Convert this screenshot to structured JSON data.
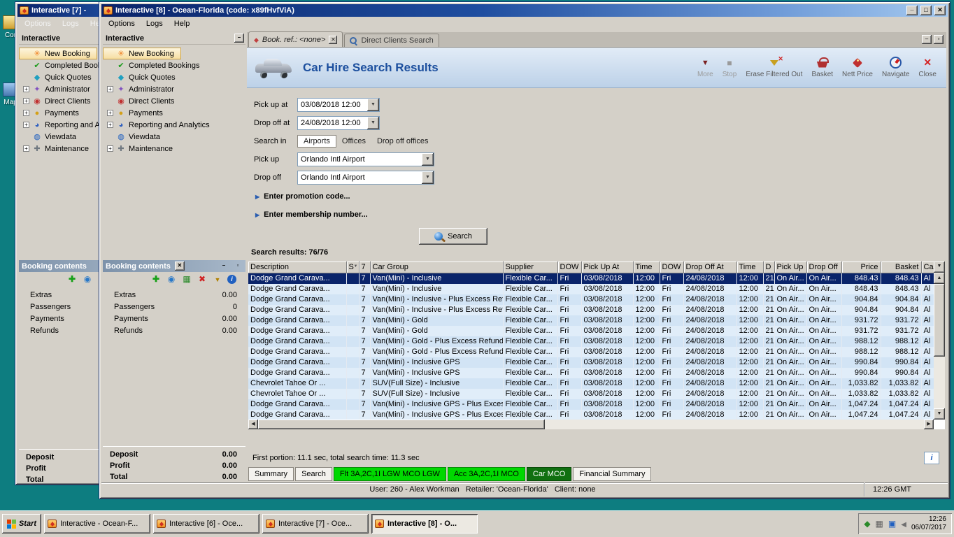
{
  "desktop": {
    "icon_labels": [
      "Cor",
      "Map"
    ]
  },
  "back_window": {
    "title": "Interactive [7] -",
    "menus": [
      "Options",
      "Logs",
      "Help"
    ],
    "sidebar_title": "Interactive",
    "tree": [
      {
        "label": "New Booking",
        "icon": "new-booking-icon",
        "expander": "",
        "selected": true
      },
      {
        "label": "Completed Bookings",
        "icon": "completed-bookings-icon",
        "expander": ""
      },
      {
        "label": "Quick Quotes",
        "icon": "quick-quotes-icon",
        "expander": ""
      },
      {
        "label": "Administrator",
        "icon": "administrator-icon",
        "expander": "+"
      },
      {
        "label": "Direct Clients",
        "icon": "direct-clients-icon",
        "expander": "+"
      },
      {
        "label": "Payments",
        "icon": "payments-icon",
        "expander": "+"
      },
      {
        "label": "Reporting and Analytics",
        "icon": "reporting-icon",
        "expander": "+"
      },
      {
        "label": "Viewdata",
        "icon": "viewdata-icon",
        "expander": ""
      },
      {
        "label": "Maintenance",
        "icon": "maintenance-icon",
        "expander": "+"
      }
    ],
    "booking_panel": {
      "title": "Booking contents",
      "items": [
        {
          "label": "Extras"
        },
        {
          "label": "Passengers"
        },
        {
          "label": "Payments"
        },
        {
          "label": "Refunds"
        }
      ],
      "totals": [
        {
          "label": "Deposit"
        },
        {
          "label": "Profit"
        },
        {
          "label": "Total"
        }
      ]
    }
  },
  "front_window": {
    "title": "Interactive [8] - Ocean-Florida (code: x89fHvfViA)",
    "menus": [
      "Options",
      "Logs",
      "Help"
    ],
    "sidebar": {
      "title": "Interactive",
      "tree": [
        {
          "label": "New Booking",
          "icon": "new-booking-icon",
          "expander": "",
          "selected": true
        },
        {
          "label": "Completed Bookings",
          "icon": "completed-bookings-icon",
          "expander": ""
        },
        {
          "label": "Quick Quotes",
          "icon": "quick-quotes-icon",
          "expander": ""
        },
        {
          "label": "Administrator",
          "icon": "administrator-icon",
          "expander": "+"
        },
        {
          "label": "Direct Clients",
          "icon": "direct-clients-icon",
          "expander": ""
        },
        {
          "label": "Payments",
          "icon": "payments-icon",
          "expander": "+"
        },
        {
          "label": "Reporting and Analytics",
          "icon": "reporting-icon",
          "expander": "+"
        },
        {
          "label": "Viewdata",
          "icon": "viewdata-icon",
          "expander": ""
        },
        {
          "label": "Maintenance",
          "icon": "maintenance-icon",
          "expander": "+"
        }
      ],
      "booking_panel": {
        "title": "Booking contents",
        "items": [
          {
            "label": "Extras",
            "value": "0.00"
          },
          {
            "label": "Passengers",
            "value": "0"
          },
          {
            "label": "Payments",
            "value": "0.00"
          },
          {
            "label": "Refunds",
            "value": "0.00"
          }
        ],
        "totals": [
          {
            "label": "Deposit",
            "value": "0.00"
          },
          {
            "label": "Profit",
            "value": "0.00"
          },
          {
            "label": "Total",
            "value": "0.00"
          }
        ]
      }
    },
    "tabs": [
      {
        "label": "Book. ref.: <none>",
        "icon": "booking-tab-icon",
        "active": true,
        "closable": true
      },
      {
        "label": "Direct Clients Search",
        "icon": "search-tab-icon",
        "active": false,
        "closable": false
      }
    ],
    "results_header": {
      "title": "Car Hire Search Results",
      "toolbar": [
        {
          "label": "More",
          "icon": "more-icon",
          "disabled": true
        },
        {
          "label": "Stop",
          "icon": "stop-icon",
          "disabled": true
        },
        {
          "label": "Erase Filtered Out",
          "icon": "erase-filter-icon",
          "disabled": false
        },
        {
          "label": "Basket",
          "icon": "basket-icon",
          "disabled": false
        },
        {
          "label": "Nett Price",
          "icon": "nett-price-icon",
          "disabled": false
        },
        {
          "label": "Navigate",
          "icon": "navigate-icon",
          "disabled": false
        },
        {
          "label": "Close",
          "icon": "close-icon",
          "disabled": false
        }
      ]
    },
    "search_form": {
      "pick_up_at": {
        "label": "Pick up at",
        "value": "03/08/2018 12:00"
      },
      "drop_off_at": {
        "label": "Drop off at",
        "value": "24/08/2018 12:00"
      },
      "search_in": {
        "label": "Search in",
        "options": [
          "Airports",
          "Offices",
          "Drop off offices"
        ],
        "selected": "Airports"
      },
      "pick_up": {
        "label": "Pick up",
        "value": "Orlando Intl Airport"
      },
      "drop_off": {
        "label": "Drop off",
        "value": "Orlando Intl Airport"
      },
      "promotion": "Enter promotion code...",
      "membership": "Enter membership number...",
      "search_button": "Search"
    },
    "results": {
      "count_text": "Search results: 76/76",
      "columns": [
        "Description",
        "S",
        "7",
        "Car Group",
        "Supplier",
        "DOW",
        "Pick Up At",
        "Time",
        "DOW",
        "Drop Off At",
        "Time",
        "D",
        "Pick Up",
        "Drop Off",
        "Price",
        "Basket",
        "Ca"
      ],
      "selected_row": 0,
      "rows": [
        [
          "Dodge Grand Carava...",
          "",
          "7",
          "Van(Mini) - Inclusive",
          "Flexible Car...",
          "Fri",
          "03/08/2018",
          "12:00",
          "Fri",
          "24/08/2018",
          "12:00",
          "21",
          "On Air...",
          "On Air...",
          "848.43",
          "848.43",
          "Al"
        ],
        [
          "Dodge Grand Carava...",
          "",
          "7",
          "Van(Mini) - Inclusive",
          "Flexible Car...",
          "Fri",
          "03/08/2018",
          "12:00",
          "Fri",
          "24/08/2018",
          "12:00",
          "21",
          "On Air...",
          "On Air...",
          "848.43",
          "848.43",
          "Al"
        ],
        [
          "Dodge Grand Carava...",
          "",
          "7",
          "Van(Mini) - Inclusive - Plus Excess Ref...",
          "Flexible Car...",
          "Fri",
          "03/08/2018",
          "12:00",
          "Fri",
          "24/08/2018",
          "12:00",
          "21",
          "On Air...",
          "On Air...",
          "904.84",
          "904.84",
          "Al"
        ],
        [
          "Dodge Grand Carava...",
          "",
          "7",
          "Van(Mini) - Inclusive - Plus Excess Ref...",
          "Flexible Car...",
          "Fri",
          "03/08/2018",
          "12:00",
          "Fri",
          "24/08/2018",
          "12:00",
          "21",
          "On Air...",
          "On Air...",
          "904.84",
          "904.84",
          "Al"
        ],
        [
          "Dodge Grand Carava...",
          "",
          "7",
          "Van(Mini) - Gold",
          "Flexible Car...",
          "Fri",
          "03/08/2018",
          "12:00",
          "Fri",
          "24/08/2018",
          "12:00",
          "21",
          "On Air...",
          "On Air...",
          "931.72",
          "931.72",
          "Al"
        ],
        [
          "Dodge Grand Carava...",
          "",
          "7",
          "Van(Mini) - Gold",
          "Flexible Car...",
          "Fri",
          "03/08/2018",
          "12:00",
          "Fri",
          "24/08/2018",
          "12:00",
          "21",
          "On Air...",
          "On Air...",
          "931.72",
          "931.72",
          "Al"
        ],
        [
          "Dodge Grand Carava...",
          "",
          "7",
          "Van(Mini) - Gold - Plus Excess Refund",
          "Flexible Car...",
          "Fri",
          "03/08/2018",
          "12:00",
          "Fri",
          "24/08/2018",
          "12:00",
          "21",
          "On Air...",
          "On Air...",
          "988.12",
          "988.12",
          "Al"
        ],
        [
          "Dodge Grand Carava...",
          "",
          "7",
          "Van(Mini) - Gold - Plus Excess Refund",
          "Flexible Car...",
          "Fri",
          "03/08/2018",
          "12:00",
          "Fri",
          "24/08/2018",
          "12:00",
          "21",
          "On Air...",
          "On Air...",
          "988.12",
          "988.12",
          "Al"
        ],
        [
          "Dodge Grand Carava...",
          "",
          "7",
          "Van(Mini) - Inclusive GPS",
          "Flexible Car...",
          "Fri",
          "03/08/2018",
          "12:00",
          "Fri",
          "24/08/2018",
          "12:00",
          "21",
          "On Air...",
          "On Air...",
          "990.84",
          "990.84",
          "Al"
        ],
        [
          "Dodge Grand Carava...",
          "",
          "7",
          "Van(Mini) - Inclusive GPS",
          "Flexible Car...",
          "Fri",
          "03/08/2018",
          "12:00",
          "Fri",
          "24/08/2018",
          "12:00",
          "21",
          "On Air...",
          "On Air...",
          "990.84",
          "990.84",
          "Al"
        ],
        [
          "Chevrolet Tahoe Or ...",
          "",
          "7",
          "SUV(Full Size) - Inclusive",
          "Flexible Car...",
          "Fri",
          "03/08/2018",
          "12:00",
          "Fri",
          "24/08/2018",
          "12:00",
          "21",
          "On Air...",
          "On Air...",
          "1,033.82",
          "1,033.82",
          "Al"
        ],
        [
          "Chevrolet Tahoe Or ...",
          "",
          "7",
          "SUV(Full Size) - Inclusive",
          "Flexible Car...",
          "Fri",
          "03/08/2018",
          "12:00",
          "Fri",
          "24/08/2018",
          "12:00",
          "21",
          "On Air...",
          "On Air...",
          "1,033.82",
          "1,033.82",
          "Al"
        ],
        [
          "Dodge Grand Carava...",
          "",
          "7",
          "Van(Mini) - Inclusive GPS - Plus Exces...",
          "Flexible Car...",
          "Fri",
          "03/08/2018",
          "12:00",
          "Fri",
          "24/08/2018",
          "12:00",
          "21",
          "On Air...",
          "On Air...",
          "1,047.24",
          "1,047.24",
          "Al"
        ],
        [
          "Dodge Grand Carava...",
          "",
          "7",
          "Van(Mini) - Inclusive GPS - Plus Exces...",
          "Flexible Car...",
          "Fri",
          "03/08/2018",
          "12:00",
          "Fri",
          "24/08/2018",
          "12:00",
          "21",
          "On Air...",
          "On Air...",
          "1,047.24",
          "1,047.24",
          "Al"
        ]
      ]
    },
    "footer": {
      "timing": "First portion: 11.1 sec, total search time: 11.3 sec",
      "tabs": [
        {
          "label": "Summary",
          "style": "plain"
        },
        {
          "label": "Search",
          "style": "plain"
        },
        {
          "label": "Flt 3A,2C,1I LGW MCO LGW",
          "style": "green"
        },
        {
          "label": "Acc 3A,2C,1I MCO",
          "style": "green"
        },
        {
          "label": "Car MCO",
          "style": "dark-green"
        },
        {
          "label": "Financial Summary",
          "style": "plain"
        }
      ],
      "status_user": "User: 260 - Alex Workman   Retailer: 'Ocean-Florida'   Client: none",
      "status_time": "12:26 GMT"
    }
  },
  "taskbar": {
    "start_label": "Start",
    "buttons": [
      {
        "label": "Interactive - Ocean-F...",
        "active": false
      },
      {
        "label": "Interactive [6] - Oce...",
        "active": false
      },
      {
        "label": "Interactive [7] - Oce...",
        "active": false
      },
      {
        "label": "Interactive [8] - O...",
        "active": true
      }
    ],
    "clock_time": "12:26",
    "clock_date": "06/07/2017"
  }
}
